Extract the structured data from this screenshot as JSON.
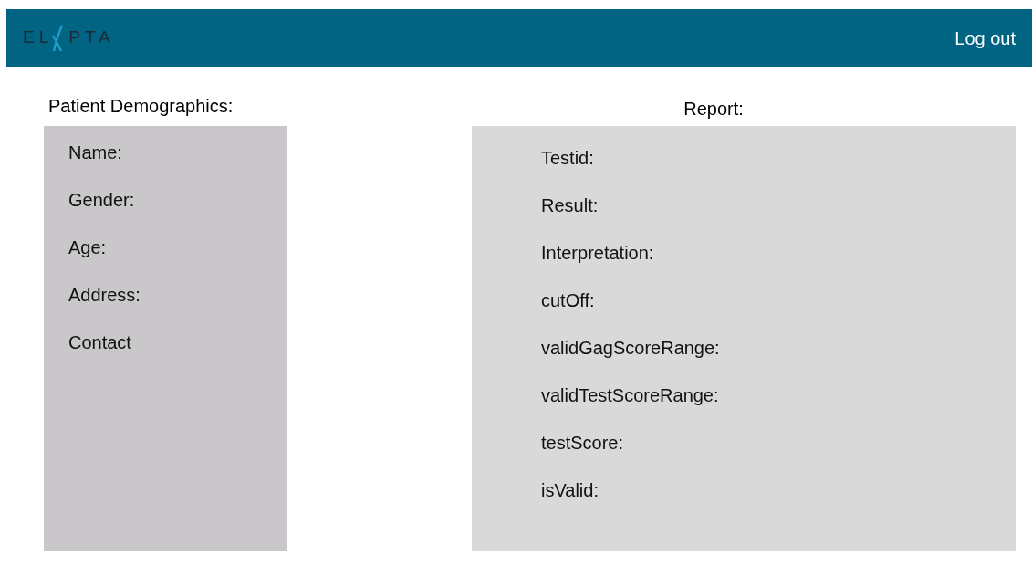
{
  "header": {
    "logo": {
      "left": "EL",
      "right": "PTA"
    },
    "logout": "Log out"
  },
  "demographics": {
    "title": "Patient Demographics:",
    "fields": [
      "Name:",
      "Gender:",
      "Age:",
      "Address:",
      "Contact"
    ]
  },
  "report": {
    "title": "Report:",
    "fields": [
      "Testid:",
      "Result:",
      "Interpretation:",
      "cutOff:",
      "validGagScoreRange:",
      "validTestScoreRange:",
      "testScore:",
      "isValid:"
    ]
  }
}
